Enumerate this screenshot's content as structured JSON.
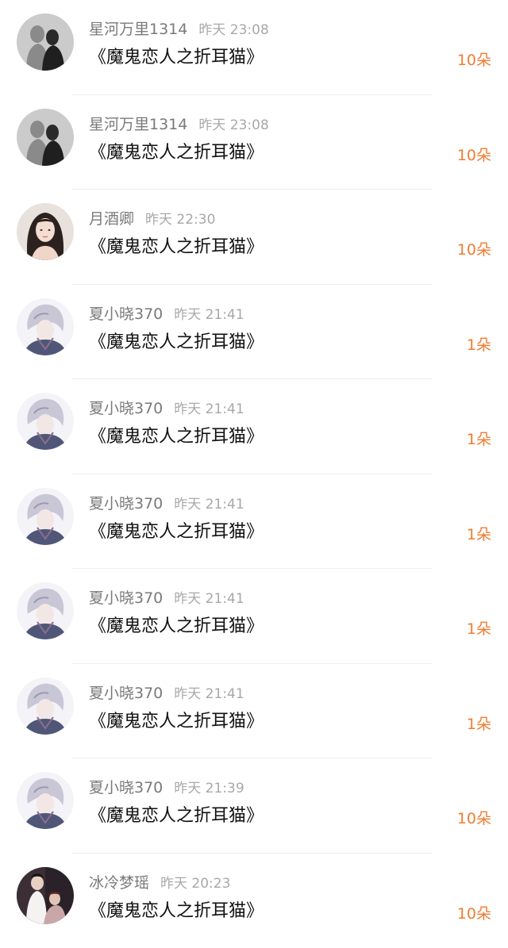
{
  "gift_records": [
    {
      "username": "星河万里1314",
      "time": "昨天 23:08",
      "gift": "《魔鬼恋人之折耳猫》",
      "count": "10朵",
      "avatar": "silhouette-couple"
    },
    {
      "username": "星河万里1314",
      "time": "昨天 23:08",
      "gift": "《魔鬼恋人之折耳猫》",
      "count": "10朵",
      "avatar": "silhouette-couple"
    },
    {
      "username": "月酒卿",
      "time": "昨天 22:30",
      "gift": "《魔鬼恋人之折耳猫》",
      "count": "10朵",
      "avatar": "woman-portrait"
    },
    {
      "username": "夏小晓370",
      "time": "昨天 21:41",
      "gift": "《魔鬼恋人之折耳猫》",
      "count": "1朵",
      "avatar": "anime-character"
    },
    {
      "username": "夏小晓370",
      "time": "昨天 21:41",
      "gift": "《魔鬼恋人之折耳猫》",
      "count": "1朵",
      "avatar": "anime-character"
    },
    {
      "username": "夏小晓370",
      "time": "昨天 21:41",
      "gift": "《魔鬼恋人之折耳猫》",
      "count": "1朵",
      "avatar": "anime-character"
    },
    {
      "username": "夏小晓370",
      "time": "昨天 21:41",
      "gift": "《魔鬼恋人之折耳猫》",
      "count": "1朵",
      "avatar": "anime-character"
    },
    {
      "username": "夏小晓370",
      "time": "昨天 21:41",
      "gift": "《魔鬼恋人之折耳猫》",
      "count": "1朵",
      "avatar": "anime-character"
    },
    {
      "username": "夏小晓370",
      "time": "昨天 21:39",
      "gift": "《魔鬼恋人之折耳猫》",
      "count": "10朵",
      "avatar": "anime-character"
    },
    {
      "username": "冰冷梦瑶",
      "time": "昨天 20:23",
      "gift": "《魔鬼恋人之折耳猫》",
      "count": "10朵",
      "avatar": "dancing-couple"
    }
  ],
  "colors": {
    "username": "#7a7a7a",
    "time": "#a8a8a8",
    "gift_title": "#111111",
    "count_accent": "#f07c32",
    "divider": "#eeeeee"
  }
}
